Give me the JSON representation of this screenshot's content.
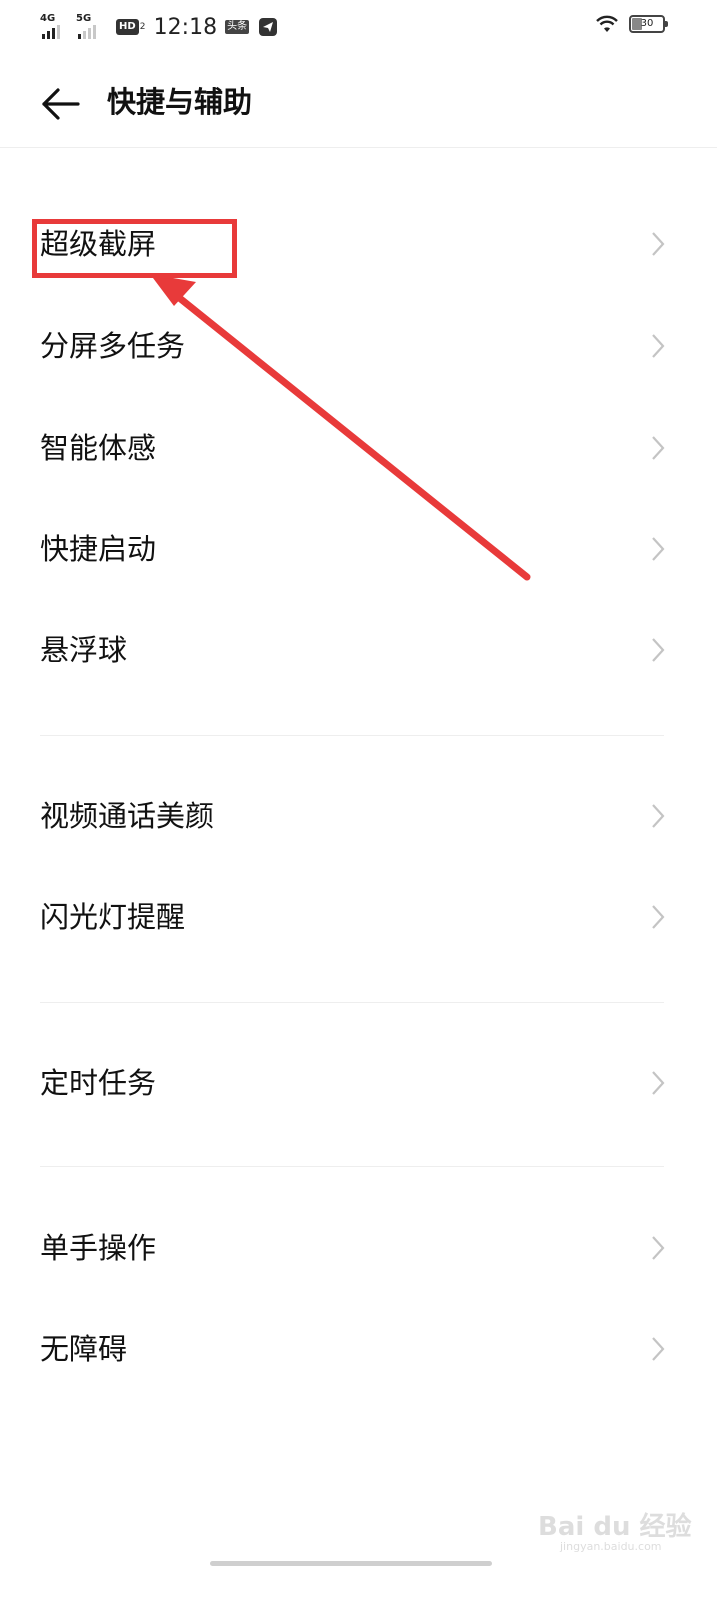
{
  "status_bar": {
    "sim1_label": "4G",
    "sim2_label": "5G",
    "hd_label": "HD",
    "hd_sub": "2",
    "time": "12:18",
    "news_badge": "头条",
    "battery_level": "30"
  },
  "header": {
    "title": "快捷与辅助"
  },
  "groups": [
    {
      "items": [
        "超级截屏",
        "分屏多任务",
        "智能体感",
        "快捷启动",
        "悬浮球"
      ]
    },
    {
      "items": [
        "视频通话美颜",
        "闪光灯提醒"
      ]
    },
    {
      "items": [
        "定时任务"
      ]
    },
    {
      "items": [
        "单手操作",
        "无障碍"
      ]
    }
  ],
  "annotation": {
    "highlight_color": "#e83a3a",
    "highlighted_item": "超级截屏"
  },
  "watermark": {
    "main": "Bai du 经验",
    "sub": "jingyan.baidu.com"
  }
}
